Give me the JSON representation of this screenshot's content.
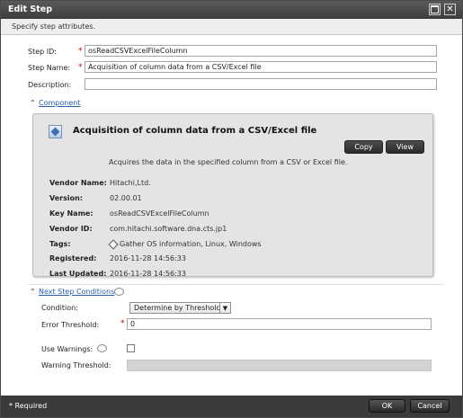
{
  "window": {
    "title": "Edit Step",
    "subtitle": "Specify step attributes."
  },
  "form": {
    "step_id_label": "Step ID:",
    "step_id_value": "osReadCSVExcelFileColumn",
    "step_name_label": "Step Name:",
    "step_name_value": "Acquisition of column data from a CSV/Excel file",
    "description_label": "Description:",
    "description_value": "",
    "required_mark": "*"
  },
  "component": {
    "section_label": "Component",
    "title": "Acquisition of column data from a CSV/Excel file",
    "copy_label": "Copy",
    "view_label": "View",
    "description": "Acquires the data in the specified column from a CSV or Excel file.",
    "fields": [
      {
        "key": "Vendor Name:",
        "value": "Hitachi,Ltd."
      },
      {
        "key": "Version:",
        "value": "02.00.01"
      },
      {
        "key": "Key Name:",
        "value": "osReadCSVExcelFileColumn"
      },
      {
        "key": "Vendor ID:",
        "value": "com.hitachi.software.dna.cts.jp1"
      },
      {
        "key": "Tags:",
        "value": "Gather OS information, Linux, Windows"
      },
      {
        "key": "Registered:",
        "value": "2016-11-28 14:56:33"
      },
      {
        "key": "Last Updated:",
        "value": "2016-11-28 14:56:33"
      }
    ]
  },
  "next_step": {
    "section_label": "Next Step Conditions",
    "condition_label": "Condition:",
    "condition_value": "Determine by Threshold",
    "error_threshold_label": "Error Threshold:",
    "error_threshold_value": "0",
    "use_warnings_label": "Use Warnings:",
    "warning_threshold_label": "Warning Threshold:"
  },
  "footer": {
    "required_note": "* Required",
    "ok_label": "OK",
    "cancel_label": "Cancel"
  },
  "icons": {
    "close": "close-icon",
    "maximize": "maximize-icon",
    "collapse": "double-chevron-up-icon",
    "info": "speech-bubble-info-icon",
    "tag": "tag-icon",
    "component": "component-cube-icon"
  }
}
